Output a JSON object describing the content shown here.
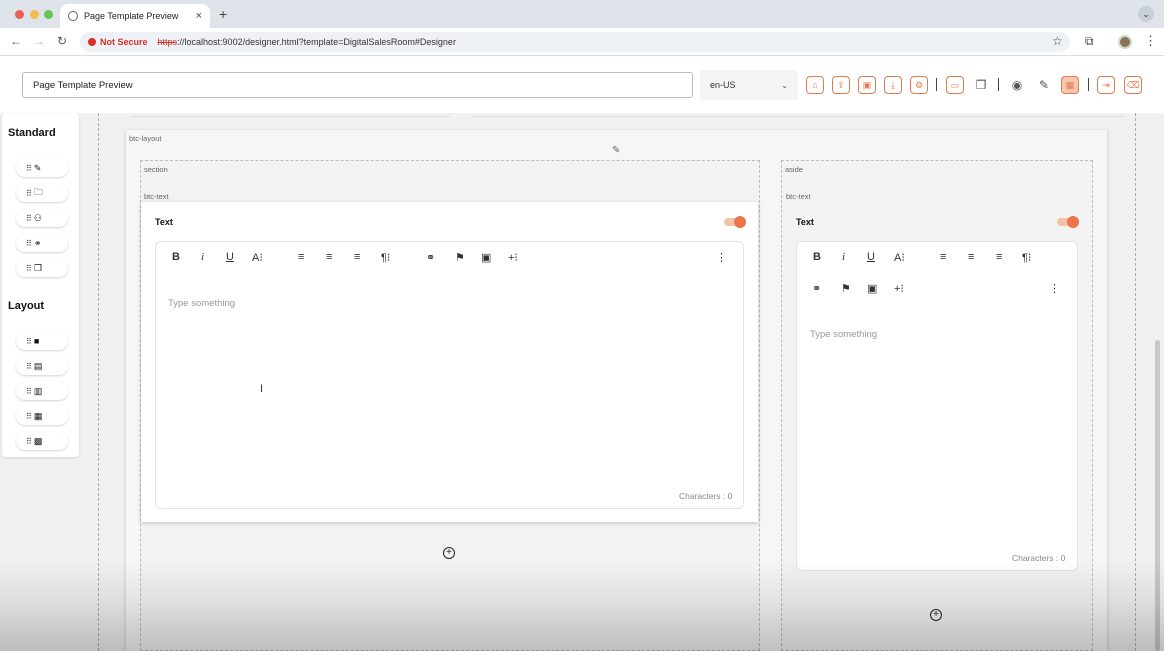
{
  "browser": {
    "tab_title": "Page Template Preview",
    "tab_close": "×",
    "new_tab": "+",
    "not_secure": "Not Secure",
    "url_scheme": "https",
    "url_rest": "://localhost:9002/designer.html?template=DigitalSalesRoom#Designer"
  },
  "toolbar": {
    "page_title_value": "Page Template Preview",
    "locale": "en-US",
    "accent_color": "#e37b50"
  },
  "palette": {
    "standard_heading": "Standard",
    "standard_items": [
      {
        "icon": "pencil-icon",
        "glyph": "✎"
      },
      {
        "icon": "folder-icon",
        "glyph": "🗀"
      },
      {
        "icon": "user-badge-icon",
        "glyph": "⚇"
      },
      {
        "icon": "link-icon",
        "glyph": "⚭"
      },
      {
        "icon": "pages-icon",
        "glyph": "❐"
      }
    ],
    "layout_heading": "Layout",
    "layout_items": [
      {
        "icon": "layout-single-icon",
        "glyph": "■"
      },
      {
        "icon": "layout-sidebar-left-icon",
        "glyph": "▤"
      },
      {
        "icon": "layout-sidebar-right-icon",
        "glyph": "▥"
      },
      {
        "icon": "layout-grid-2-icon",
        "glyph": "▦"
      },
      {
        "icon": "layout-grid-3-icon",
        "glyph": "▩"
      }
    ]
  },
  "canvas": {
    "layout_label": "btc-layout",
    "section_label": "section",
    "aside_label": "aside",
    "section_text": {
      "component_label": "btc-text",
      "title": "Text",
      "placeholder": "Type something",
      "characters": "Characters : 0",
      "enabled": true
    },
    "aside_text": {
      "component_label": "btc-text",
      "title": "Text",
      "placeholder": "Type something",
      "characters": "Characters : 0",
      "enabled": true
    }
  }
}
